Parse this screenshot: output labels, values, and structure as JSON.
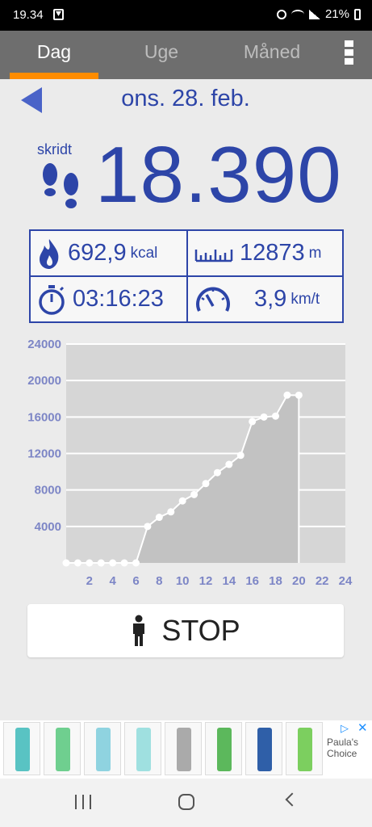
{
  "status_bar": {
    "time": "19.34",
    "battery": "21%"
  },
  "tabs": [
    {
      "label": "Dag",
      "active": true
    },
    {
      "label": "Uge",
      "active": false
    },
    {
      "label": "Måned",
      "active": false
    }
  ],
  "date": "ons. 28. feb.",
  "steps": {
    "label": "skridt",
    "value": "18.390"
  },
  "stats": {
    "kcal": {
      "value": "692,9",
      "unit": "kcal"
    },
    "distance": {
      "value": "12873",
      "unit": "m"
    },
    "duration": {
      "value": "03:16:23"
    },
    "speed": {
      "value": "3,9",
      "unit": "km/t"
    }
  },
  "colors": {
    "accent": "#2d45a8",
    "tab_indicator": "#ff8c00",
    "tab_bar": "#6e6e6e",
    "chart_area": "#c2c2c2",
    "chart_bg": "#d6d6d6"
  },
  "chart_data": {
    "type": "area",
    "x": [
      0,
      1,
      2,
      3,
      4,
      5,
      6,
      7,
      8,
      9,
      10,
      11,
      12,
      13,
      14,
      15,
      16,
      17,
      18,
      19,
      20
    ],
    "values": [
      0,
      0,
      0,
      0,
      0,
      0,
      0,
      4000,
      5000,
      5600,
      6800,
      7500,
      8700,
      9900,
      10800,
      11800,
      15500,
      16000,
      16100,
      18400,
      18390
    ],
    "x_ticks": [
      "2",
      "4",
      "6",
      "8",
      "10",
      "12",
      "14",
      "16",
      "18",
      "20",
      "22",
      "24"
    ],
    "y_ticks": [
      "24000",
      "20000",
      "16000",
      "12000",
      "8000",
      "4000"
    ],
    "xlim": [
      0,
      24
    ],
    "ylim": [
      0,
      24000
    ],
    "grid": true
  },
  "stop_button": {
    "label": "STOP"
  },
  "ad": {
    "brand": "Paula's Choice"
  }
}
